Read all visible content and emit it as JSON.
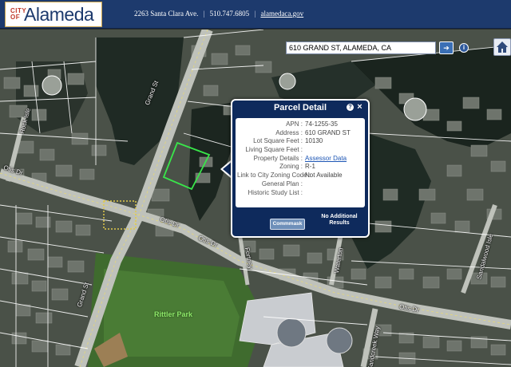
{
  "header": {
    "logo_prefix": "CITY OF",
    "logo_name": "Alameda",
    "address": "2263 Santa Clara Ave.",
    "phone": "510.747.6805",
    "website": "alamedaca.gov",
    "separator": "|",
    "brand_color": "#1d3a6d"
  },
  "search": {
    "value": "610 GRAND ST, ALAMEDA, CA",
    "button_icon": "arrow-right-icon",
    "help_icon": "info-icon",
    "home_icon": "home-icon"
  },
  "popup": {
    "title": "Parcel Detail",
    "help_glyph": "?",
    "close_glyph": "×",
    "fields": [
      {
        "key": "APN :",
        "value": "74-1255-35"
      },
      {
        "key": "Address :",
        "value": "610 GRAND ST"
      },
      {
        "key": "Lot Square Feet :",
        "value": "10130"
      },
      {
        "key": "Living Square Feet :",
        "value": ""
      },
      {
        "key": "Property Details :",
        "value": "Assessor Data"
      },
      {
        "key": "Zoning :",
        "value": "R-1"
      },
      {
        "key": "Link to City Zoning Code :",
        "value": "Not Available"
      },
      {
        "key": "General Plan :",
        "value": ""
      },
      {
        "key": "Historic Study List :",
        "value": ""
      }
    ],
    "comm_button": "Commmask",
    "no_results": "No Additional Results"
  },
  "map_labels": {
    "grand_st_upper": "Grand St",
    "grand_st_lower": "Grand St",
    "otis_dr_left": "Otis Dr",
    "otis_dr_mid": "Otis Dr",
    "otis_dr_mid2": "Otis Dr",
    "otis_dr_right": "Otis Dr",
    "rock_isle": "Rock Isle",
    "waterton": "Waterton",
    "sandalwood": "Sandalwood Isle",
    "sandcreek": "Sandcreek Way",
    "fortney": "Fortney",
    "park": "Rittler Park"
  },
  "colors": {
    "parcel_highlight": "#39e64a",
    "popup_bg": "#0e2a5c",
    "park": "#8fe86a"
  }
}
